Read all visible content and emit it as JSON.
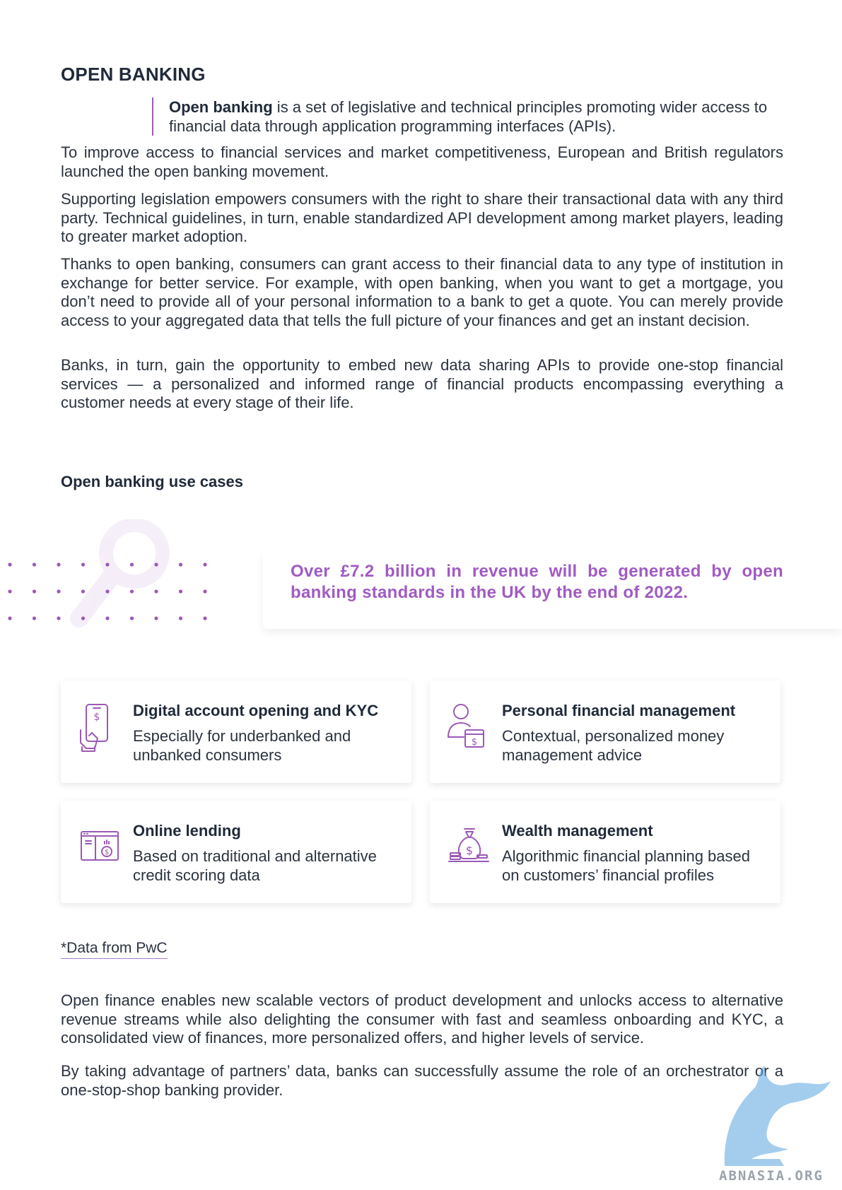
{
  "title": "OPEN BANKING",
  "definition": {
    "term": "Open banking",
    "text": " is a set of legislative and technical principles promoting wider access to financial data through application programming interfaces (APIs)."
  },
  "paragraphs": [
    "To improve access to financial services and market competitiveness, European and British regulators launched the open banking movement.",
    "Supporting legislation empowers consumers with the right to share their transactional data with any third party. Technical guidelines, in turn, enable standardized API development among market players, leading to greater market adoption.",
    "Thanks to open banking, consumers can grant access to their financial data to any type of institution in exchange for better service. For example, with open banking, when you want to get a mortgage, you don’t need to provide all of your personal information to a bank to get a quote. You can merely provide access to your aggregated data that tells the full picture of your finances and get an instant decision.",
    "Banks, in turn, gain the opportunity to embed new data sharing APIs to provide one-stop financial services — a personalized and informed range of financial products encompassing everything a customer needs at every stage of their life."
  ],
  "use_cases_heading": "Open banking use cases",
  "stat": "Over £7.2 billion in revenue will be generated by open banking standards in the UK by the end of 2022.",
  "cards": [
    {
      "title": "Digital account opening and KYC",
      "desc": "Especially for underbanked and unbanked consumers",
      "icon": "mobile-payment-icon"
    },
    {
      "title": "Personal financial management",
      "desc": "Contextual, personalized money management advice",
      "icon": "person-wallet-icon"
    },
    {
      "title": "Online lending",
      "desc": "Based on traditional and alternative credit scoring data",
      "icon": "browser-money-icon"
    },
    {
      "title": "Wealth management",
      "desc": "Algorithmic financial planning based on customers’ financial profiles",
      "icon": "money-bag-icon"
    }
  ],
  "source_note": "*Data from PwC",
  "closing_paragraphs": [
    "Open finance enables new scalable vectors of product development and unlocks access to alternative revenue streams while also delighting the consumer with fast and seamless onboarding and KYC, a consolidated view of finances, more personalized offers, and higher levels of service.",
    "By taking advantage of partners’ data, banks can successfully assume the role of an orchestrator or a one-stop-shop banking provider."
  ],
  "watermark": "ABNASIA.ORG",
  "colors": {
    "accent": "#a05bc2",
    "text": "#2b3340",
    "heading": "#1f2a3a"
  }
}
